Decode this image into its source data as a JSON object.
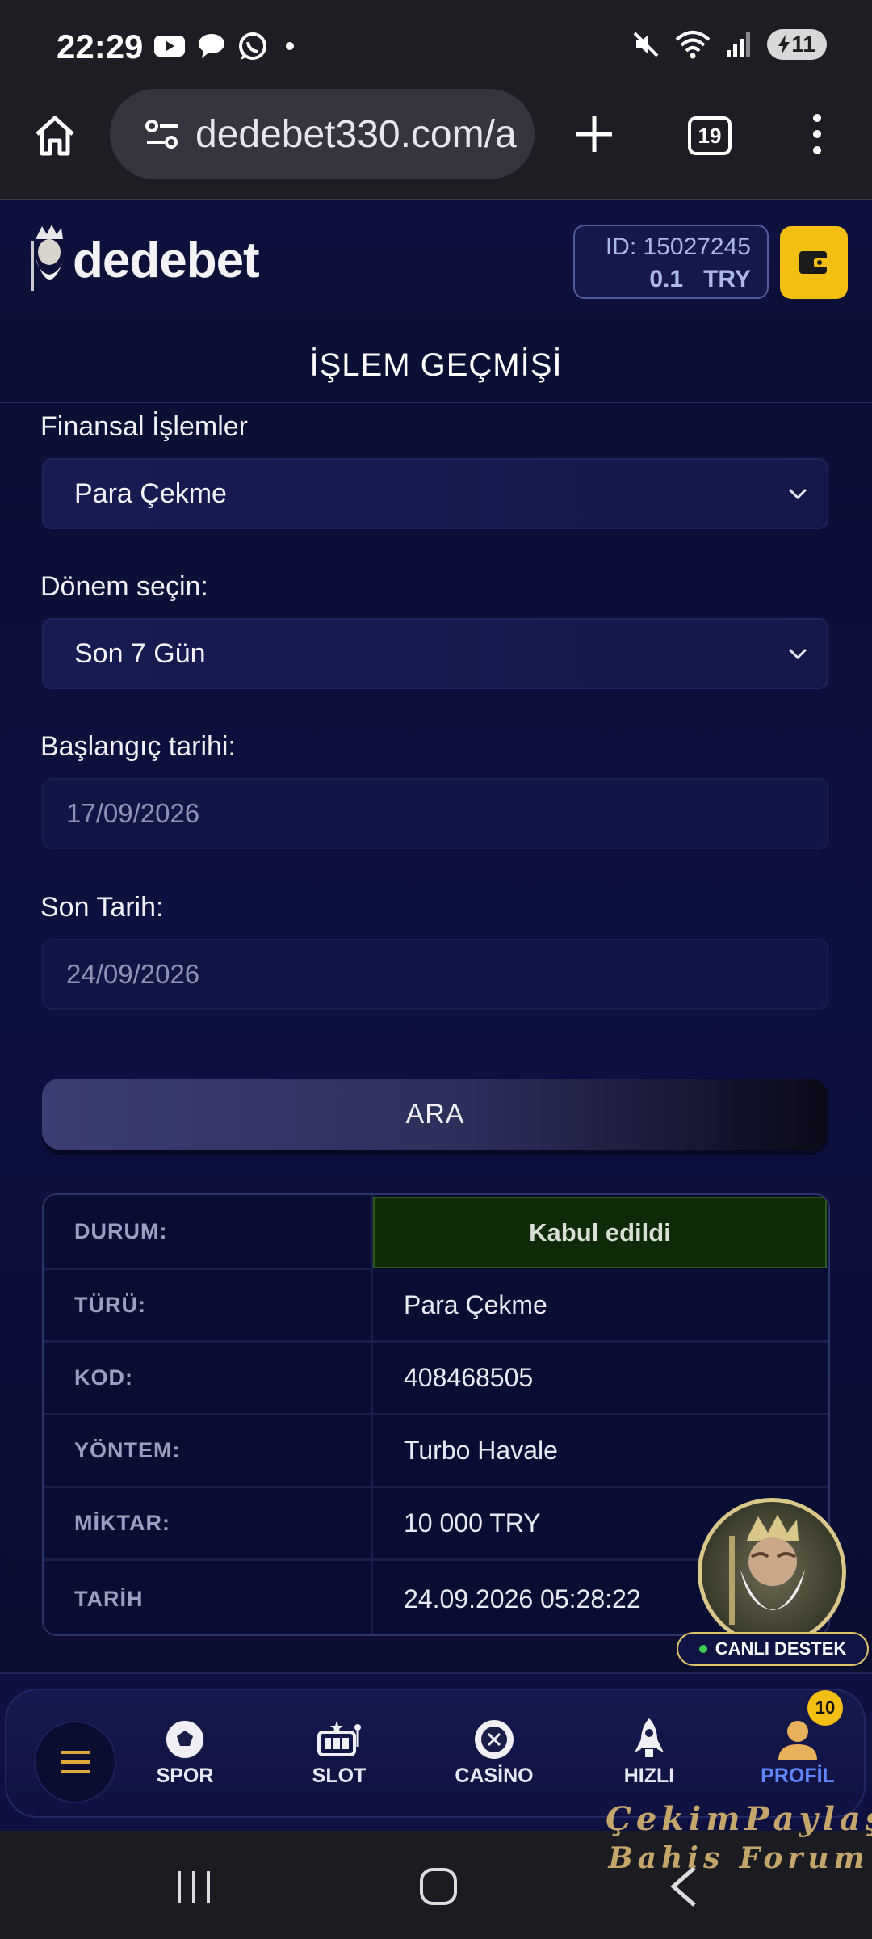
{
  "status_bar": {
    "time": "22:29",
    "left_icons": [
      "youtube-icon",
      "chat-icon",
      "whatsapp-icon",
      "dot-icon"
    ],
    "right_icons": [
      "mute-icon",
      "wifi-icon",
      "signal-icon"
    ],
    "battery_level": "11"
  },
  "browser": {
    "url": "dedebet330.com/a",
    "tab_count": "19"
  },
  "header": {
    "logo_text": "dedebet",
    "user_id": "ID: 15027245",
    "balance_amount": "0.1",
    "balance_currency": "TRY"
  },
  "page": {
    "title": "İŞLEM GEÇMİŞİ"
  },
  "form": {
    "financial_label": "Finansal İşlemler",
    "financial_value": "Para Çekme",
    "period_label": "Dönem seçin:",
    "period_value": "Son 7 Gün",
    "start_label": "Başlangıç tarihi:",
    "start_value": "17/09/2026",
    "end_label": "Son Tarih:",
    "end_value": "24/09/2026",
    "search_button": "ARA"
  },
  "result": {
    "rows": [
      {
        "key": "DURUM:",
        "value": "Kabul edildi"
      },
      {
        "key": "TÜRÜ:",
        "value": "Para Çekme"
      },
      {
        "key": "KOD:",
        "value": "408468505"
      },
      {
        "key": "YÖNTEM:",
        "value": "Turbo Havale"
      },
      {
        "key": "MİKTAR:",
        "value": "10 000 TRY"
      },
      {
        "key": "TARİH",
        "value": "24.09.2026 05:28:22"
      }
    ]
  },
  "support": {
    "label": "CANLI DESTEK"
  },
  "bottom_nav": {
    "items": [
      {
        "label": "SPOR"
      },
      {
        "label": "SLOT"
      },
      {
        "label": "CASİNO"
      },
      {
        "label": "HIZLI"
      },
      {
        "label": "PROFİL"
      }
    ],
    "profile_badge": "10"
  },
  "watermark": {
    "line1": "ÇekimPaylaş",
    "line2": "Bahis Forum"
  }
}
